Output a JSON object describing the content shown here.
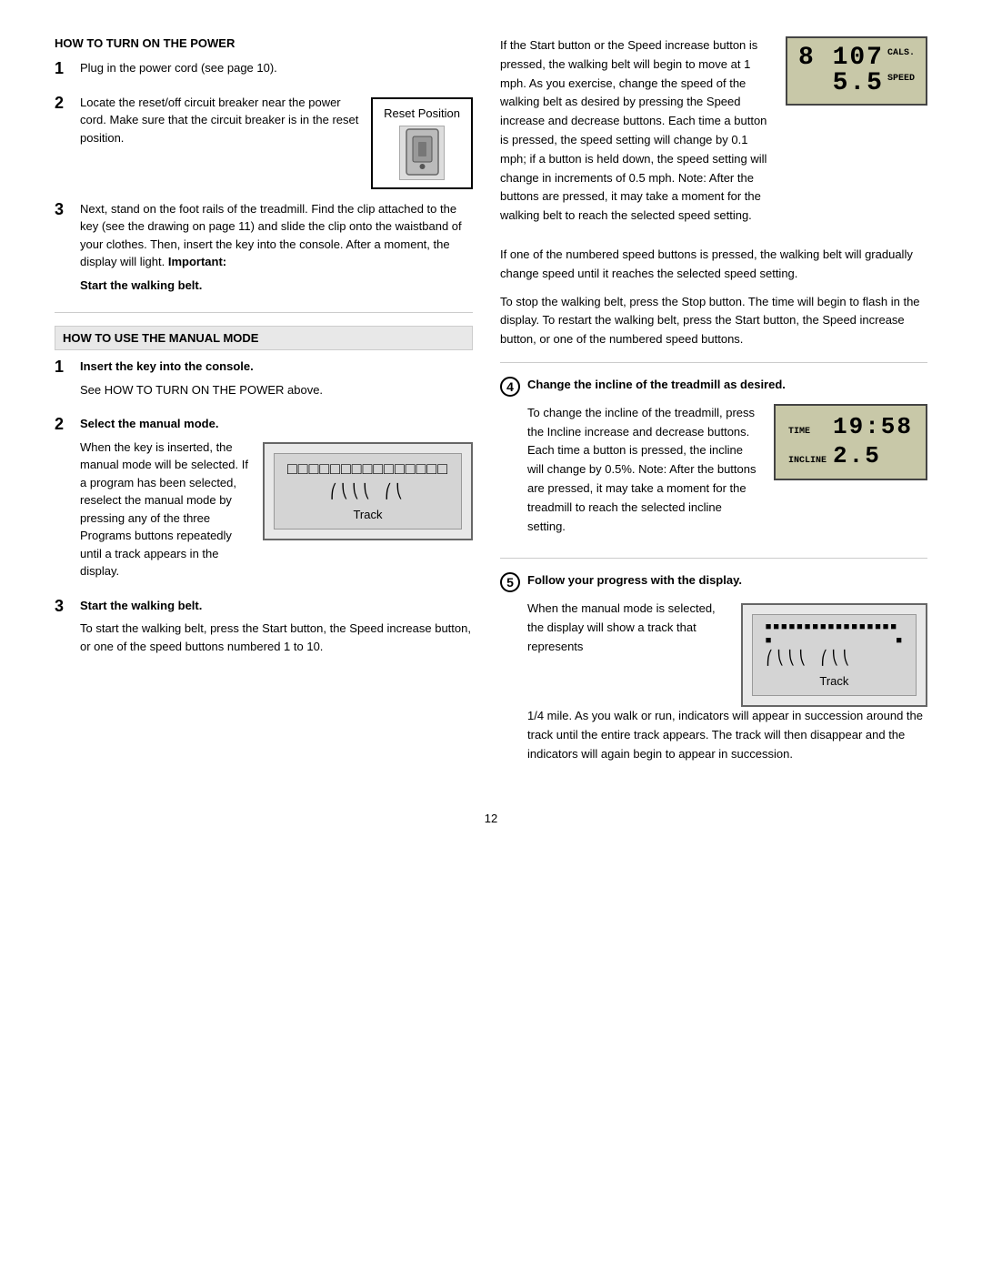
{
  "left": {
    "section1_title": "HOW TO TURN ON THE POWER",
    "step1_text": "Plug in the power cord (see page 10).",
    "step2_text_a": "Locate the reset/off circuit breaker near the power cord. Make sure that the circuit breaker is in the reset position.",
    "reset_pos_label": "Reset Position",
    "step3_para1": "Next, stand on the foot rails of the treadmill. Find the clip attached to the key (see the drawing on page 11) and slide the clip onto the waistband of your clothes. Then, insert the key into the console. After a moment, the display will light.",
    "step3_important_label": "Important:",
    "step3_bold": "Start the walking belt.",
    "section2_title": "HOW TO USE THE MANUAL MODE",
    "step1_bold": "Insert the key into the console.",
    "step1_sub": "See HOW TO TURN ON THE POWER above.",
    "step2_bold": "Select the manual mode.",
    "step2_text": "When the key is inserted, the manual mode will be selected. If a program has been selected, reselect the manual mode by pressing any of the three Programs buttons repeatedly until a track appears in the display.",
    "track_label": "Track",
    "step3_text": "To start the walking belt, press the Start button, the Speed increase button, or one of the speed buttons numbered 1 to 10."
  },
  "right": {
    "para1": "If the Start button or the Speed increase button is pressed, the walking belt will begin to move at 1 mph. As you exercise, change the speed of the walking belt as desired by pressing the Speed increase and decrease buttons. Each time a button is pressed, the speed setting will change by 0.1 mph; if a button is held down, the speed setting will change in increments of 0.5 mph. Note: After the buttons are pressed, it may take a moment for the walking belt to reach the selected speed setting.",
    "para2": "If one of the numbered speed buttons is pressed, the walking belt will gradually change speed until it reaches the selected speed setting.",
    "para3": "To stop the walking belt, press the Stop button. The time will begin to flash in the display. To restart the walking belt, press the Start button, the Speed increase button, or one of the numbered speed buttons.",
    "step4_bold": "Change the incline of the treadmill as desired.",
    "step4_text": "To change the incline of the treadmill, press the Incline increase and decrease buttons. Each time a button is pressed, the incline will change by 0.5%. Note: After the buttons are pressed, it may take a moment for the treadmill to reach the selected incline setting.",
    "step5_bold": "Follow your progress with the display.",
    "step5_text_a": "When the manual mode is selected, the display will show a track that represents",
    "step5_text_b": "1/4 mile. As you walk or run, indicators will appear in succession around the track until the entire track appears. The track will then disappear and the indicators will again begin to appear in succession.",
    "track_label": "Track",
    "lcd_top_num": "8 107",
    "lcd_cals": "CALS.",
    "lcd_bottom_num": "5.5",
    "lcd_speed": "SPEED",
    "incline_time_label": "TIME",
    "incline_time_val": "19:58",
    "incline_label": "INCLINE",
    "incline_val": "2.5"
  },
  "page_number": "12"
}
